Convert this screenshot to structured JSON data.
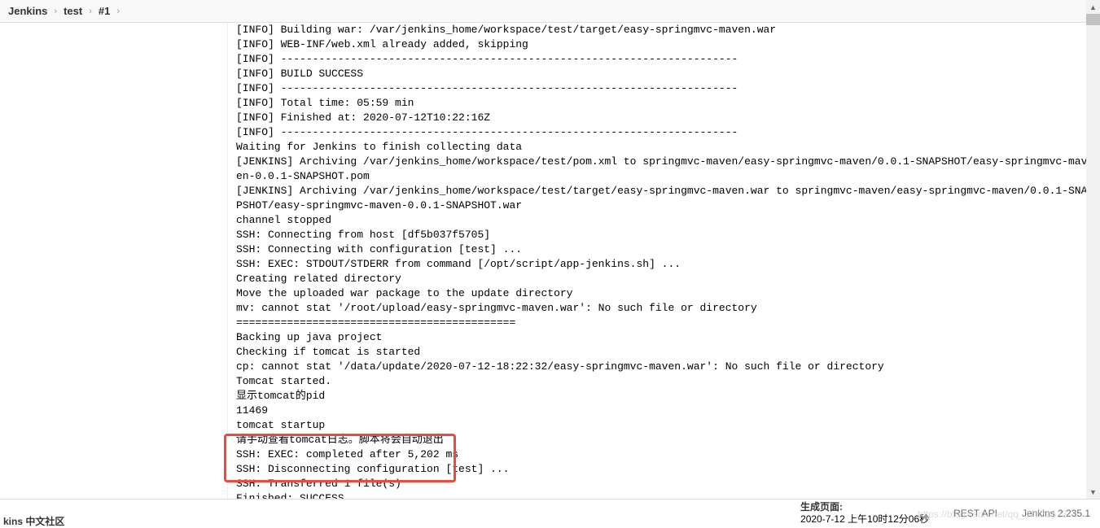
{
  "breadcrumb": {
    "items": [
      "Jenkins",
      "test",
      "#1"
    ]
  },
  "console": {
    "text": "[INFO] Building war: /var/jenkins_home/workspace/test/target/easy-springmvc-maven.war\n[INFO] WEB-INF/web.xml already added, skipping\n[INFO] ------------------------------------------------------------------------\n[INFO] BUILD SUCCESS\n[INFO] ------------------------------------------------------------------------\n[INFO] Total time: 05:59 min\n[INFO] Finished at: 2020-07-12T10:22:16Z\n[INFO] ------------------------------------------------------------------------\nWaiting for Jenkins to finish collecting data\n[JENKINS] Archiving /var/jenkins_home/workspace/test/pom.xml to springmvc-maven/easy-springmvc-maven/0.0.1-SNAPSHOT/easy-springmvc-maven-0.0.1-SNAPSHOT.pom\n[JENKINS] Archiving /var/jenkins_home/workspace/test/target/easy-springmvc-maven.war to springmvc-maven/easy-springmvc-maven/0.0.1-SNAPSHOT/easy-springmvc-maven-0.0.1-SNAPSHOT.war\nchannel stopped\nSSH: Connecting from host [df5b037f5705]\nSSH: Connecting with configuration [test] ...\nSSH: EXEC: STDOUT/STDERR from command [/opt/script/app-jenkins.sh] ...\nCreating related directory\nMove the uploaded war package to the update directory\nmv: cannot stat '/root/upload/easy-springmvc-maven.war': No such file or directory\n============================================\nBacking up java project\nChecking if tomcat is started\ncp: cannot stat '/data/update/2020-07-12-18:22:32/easy-springmvc-maven.war': No such file or directory\nTomcat started.\n显示tomcat的pid\n11469\ntomcat startup\n请手动查看tomcat日志。脚本将会自动退出\nSSH: EXEC: completed after 5,202 ms\nSSH: Disconnecting configuration [test] ...\nSSH: Transferred 1 file(s)\nFinished: SUCCESS"
  },
  "footer": {
    "gen_label": "生成页面:",
    "gen_time": "2020-7-12 上午10时12分06秒",
    "rest_api": "REST API",
    "version": "Jenkins 2.235.1"
  },
  "community": "kins 中文社区",
  "watermark": "https://blog.csdn.net/qq_37671523"
}
